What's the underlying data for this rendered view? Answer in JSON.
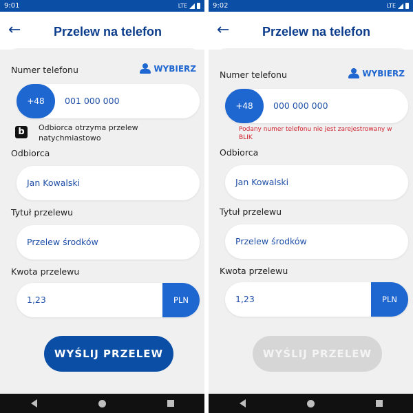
{
  "left": {
    "status": {
      "time": "9:01",
      "network": "LTE"
    },
    "title": "Przelew na telefon",
    "phone_label": "Numer telefonu",
    "choose_label": "WYBIERZ",
    "prefix": "+48",
    "phone_value": "001 000 000",
    "blik_icon_letter": "b",
    "blik_info": "Odbiorca otrzyma przelew natychmiastowo",
    "recipient_label": "Odbiorca",
    "recipient_value": "Jan Kowalski",
    "transfer_title_label": "Tytuł przelewu",
    "transfer_title_value": "Przelew środków",
    "amount_label": "Kwota przelewu",
    "amount_value": "1,23",
    "currency": "PLN",
    "send_button": "WYŚLIJ PRZELEW",
    "send_enabled": true
  },
  "right": {
    "status": {
      "time": "9:02",
      "network": "LTE"
    },
    "title": "Przelew na telefon",
    "phone_label": "Numer telefonu",
    "choose_label": "WYBIERZ",
    "prefix": "+48",
    "phone_value": "000 000 000",
    "error_text": "Podany numer telefonu nie jest zarejestrowany w BLIK",
    "recipient_label": "Odbiorca",
    "recipient_value": "Jan Kowalski",
    "transfer_title_label": "Tytuł przelewu",
    "transfer_title_value": "Przelew środków",
    "amount_label": "Kwota przelewu",
    "amount_value": "1,23",
    "currency": "PLN",
    "send_button": "WYŚLIJ PRZELEW",
    "send_enabled": false
  },
  "colors": {
    "primary": "#1e66d0",
    "dark_blue": "#0b4ea6",
    "error": "#d0202a",
    "disabled": "#d6d6d6"
  }
}
